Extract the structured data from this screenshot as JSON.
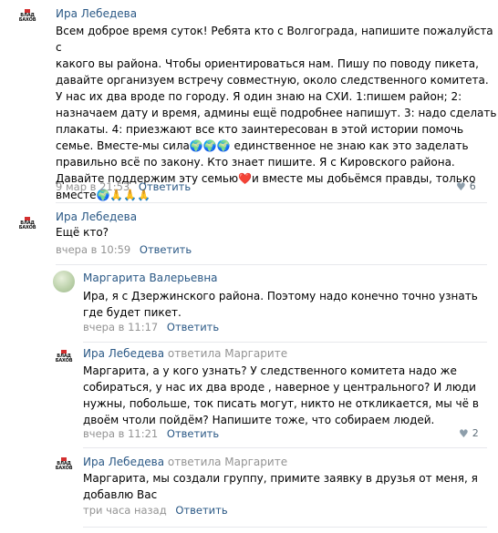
{
  "comments": [
    {
      "author": "Ира Лебедева",
      "text_lines": [
        "Всем доброе время суток! Ребята кто с Волгограда, напишите пожалуйста с",
        "какого вы района. Чтобы ориентироваться нам. Пишу по поводу пикета,",
        "давайте организуем встречу совместную, около следственного комитета.",
        "У нас их два вроде по городу. Я один знаю на СХИ. 1:пишем район; 2:",
        "назначаем дату и время, админы ещё подробнее напишут. 3: надо сделать",
        "плакаты. 4: приезжают все кто заинтересован в этой истории помочь",
        "семье. Вместе-мы сила🌍🌍🌍 единственное не знаю как это заделать",
        "правильно всё по закону. Кто знает пишите. Я с Кировского района.",
        "Давайте поддержим эту семью❤️и вместе мы добьёмся правды, только",
        "вместе🌍🙏🙏🙏"
      ],
      "time": "9 мар в 21:53",
      "reply": "Ответить",
      "likes": "6"
    },
    {
      "author": "Ира Лебедева",
      "text_lines": [
        "Ещё кто?"
      ],
      "time": "вчера в 10:59",
      "reply": "Ответить"
    },
    {
      "author": "Маргарита Валерьевна",
      "text_lines": [
        "Ира, я с Дзержинского района. Поэтому надо конечно точно узнать",
        "где будет пикет."
      ],
      "time": "вчера в 11:17",
      "reply": "Ответить"
    },
    {
      "author": "Ира Лебедева",
      "replied_to": "ответила Маргарите",
      "text_lines": [
        "Маргарита, а у кого узнать? У следственного комитета надо же",
        "собираться, у нас их два вроде , наверное у центрального? И люди",
        "нужны, побольше, ток писать могут, никто не откликается, мы чё в",
        "двоём чтоли пойдём? Напишите тоже, что собираем людей."
      ],
      "time": "вчера в 11:21",
      "reply": "Ответить",
      "likes": "2"
    },
    {
      "author": "Ира Лебедева",
      "replied_to": "ответила Маргарите",
      "text_lines": [
        "Маргарита, мы создали группу, примите заявку в друзья от меня, я",
        "добавлю Вас"
      ],
      "time": "три часа назад",
      "reply": "Ответить"
    }
  ],
  "avatar_logo_text": "ВЛАД\nБАХОВ",
  "colors": {
    "link": "#2a5885",
    "meta": "#939393",
    "accent_red": "#d32f2f"
  }
}
